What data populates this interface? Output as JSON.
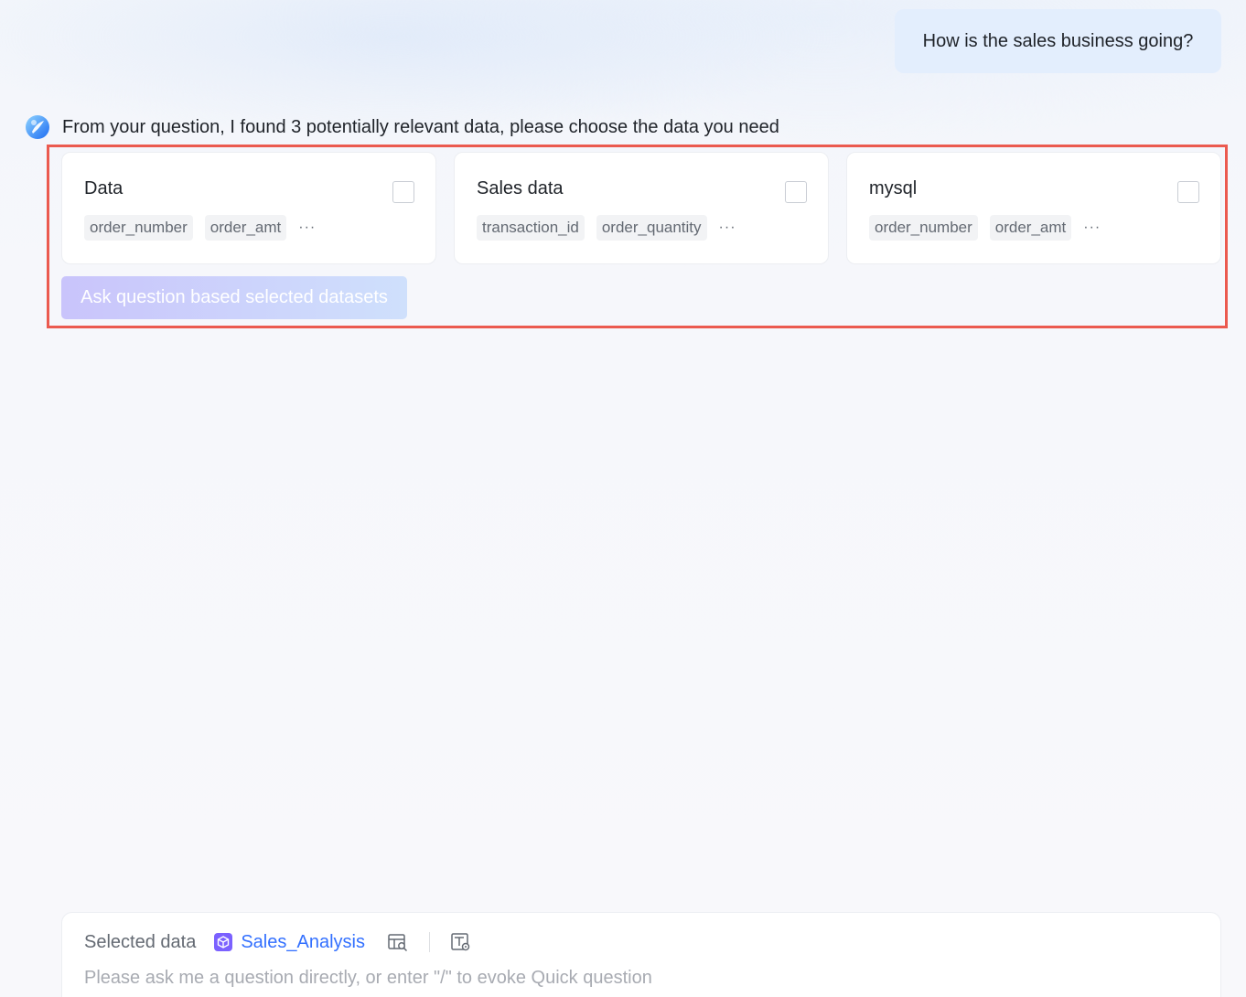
{
  "user_message": "How is the sales business going?",
  "assistant": {
    "text": "From your question, I found 3 potentially relevant data, please choose the data you need",
    "avatar_icon": "bot-avatar-icon"
  },
  "datasets": [
    {
      "title": "Data",
      "fields": [
        "order_number",
        "order_amt"
      ],
      "more": "···",
      "checked": false
    },
    {
      "title": "Sales data",
      "fields": [
        "transaction_id",
        "order_quantity"
      ],
      "more": "···",
      "checked": false
    },
    {
      "title": "mysql",
      "fields": [
        "order_number",
        "order_amt"
      ],
      "more": "···",
      "checked": false
    }
  ],
  "ask_button_label": "Ask question based selected datasets",
  "input_panel": {
    "selected_label": "Selected data",
    "selected_dataset": "Sales_Analysis",
    "dataset_icon": "dataset-cube-icon",
    "tool_icons": [
      "table-search-icon",
      "table-settings-icon"
    ],
    "placeholder": "Please ask me a question directly, or enter \"/\" to evoke Quick question"
  },
  "colors": {
    "accent": "#3370ff",
    "highlight_frame": "#eb5a4f",
    "user_bubble": "#e3eefd"
  }
}
